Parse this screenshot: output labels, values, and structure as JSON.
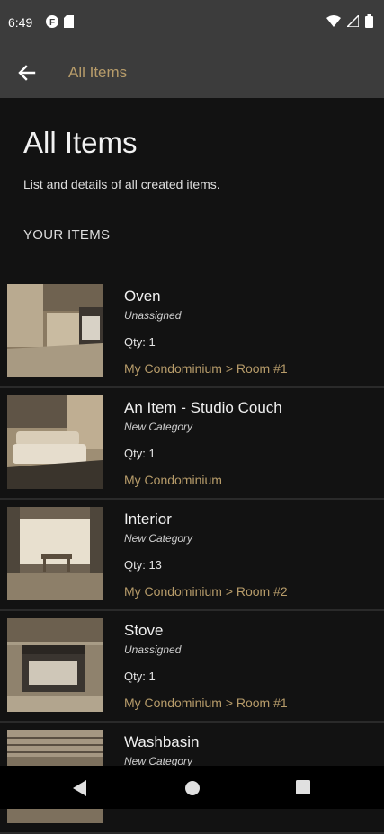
{
  "status": {
    "time": "6:49"
  },
  "appbar": {
    "title": "All Items"
  },
  "header": {
    "title": "All Items",
    "subtitle": "List and details of all created items.",
    "section": "YOUR ITEMS"
  },
  "items": [
    {
      "name": "Oven",
      "category": "Unassigned",
      "qty": "Qty: 1",
      "location": "My Condominium > Room #1"
    },
    {
      "name": "An Item - Studio Couch",
      "category": "New Category",
      "qty": "Qty: 1",
      "location": "My Condominium"
    },
    {
      "name": "Interior",
      "category": "New Category",
      "qty": "Qty: 13",
      "location": "My Condominium > Room #2"
    },
    {
      "name": "Stove",
      "category": "Unassigned",
      "qty": "Qty: 1",
      "location": "My Condominium > Room #1"
    },
    {
      "name": "Washbasin",
      "category": "New Category",
      "qty": "",
      "location": ""
    }
  ],
  "colors": {
    "accent": "#b79c6a",
    "background": "#121212",
    "appbar": "#3c3c3c"
  }
}
